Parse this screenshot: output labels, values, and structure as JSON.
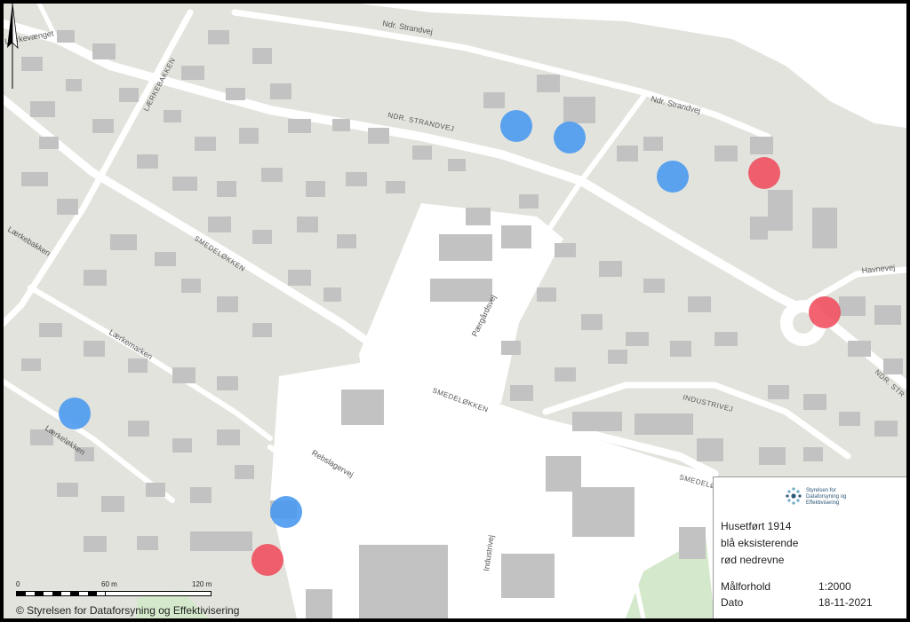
{
  "map": {
    "streets": {
      "ndr_strandvej_upper": "Ndr. Strandvej",
      "ndr_strandvej_right": "Ndr. Strandvej",
      "ndr_strandvej_caps": "NDR. STRANDVEJ",
      "ndr_strandvej_far": "NDR. STR",
      "laerkevaenget": "Lærkevænget",
      "laerkebakken_caps": "LÆRKEBAKKEN",
      "laerkebakken": "Lærkebakken",
      "smedeloekken_upper": "SMEDELØKKEN",
      "smedeloekken_mid": "SMEDELØKKEN",
      "smedeloekken_right": "SMEDELØ",
      "laerkemarken": "Lærkemarken",
      "laerkeloekken": "Lærkeløkken",
      "paergaardsvej": "Pærgårdsvej",
      "rebslagervej": "Rebslagervej",
      "industrivej_caps": "INDUSTRIVEJ",
      "industrivej": "Industrivej",
      "havnevej": "Havnevej"
    },
    "markers": [
      {
        "status": "existing",
        "color": "#4a9af0"
      },
      {
        "status": "existing",
        "color": "#4a9af0"
      },
      {
        "status": "existing",
        "color": "#4a9af0"
      },
      {
        "status": "existing",
        "color": "#4a9af0"
      },
      {
        "status": "existing",
        "color": "#4a9af0"
      },
      {
        "status": "demolished",
        "color": "#f04658"
      },
      {
        "status": "demolished",
        "color": "#f04658"
      },
      {
        "status": "demolished",
        "color": "#f04658"
      }
    ]
  },
  "legend": {
    "logo_line1": "Styrelsen for",
    "logo_line2": "Dataforsyning og",
    "logo_line3": "Effektivisering",
    "line1": "Husetført 1914",
    "line2": "blå eksisterende",
    "line3": "rød nedrevne",
    "scale_label": "Målforhold",
    "scale_value": "1:2000",
    "date_label": "Dato",
    "date_value": "18-11-2021"
  },
  "scalebar": {
    "label_0": "0",
    "label_60": "60 m",
    "label_120": "120 m"
  },
  "copyright": "© Styrelsen for Dataforsyning og Effektivisering"
}
